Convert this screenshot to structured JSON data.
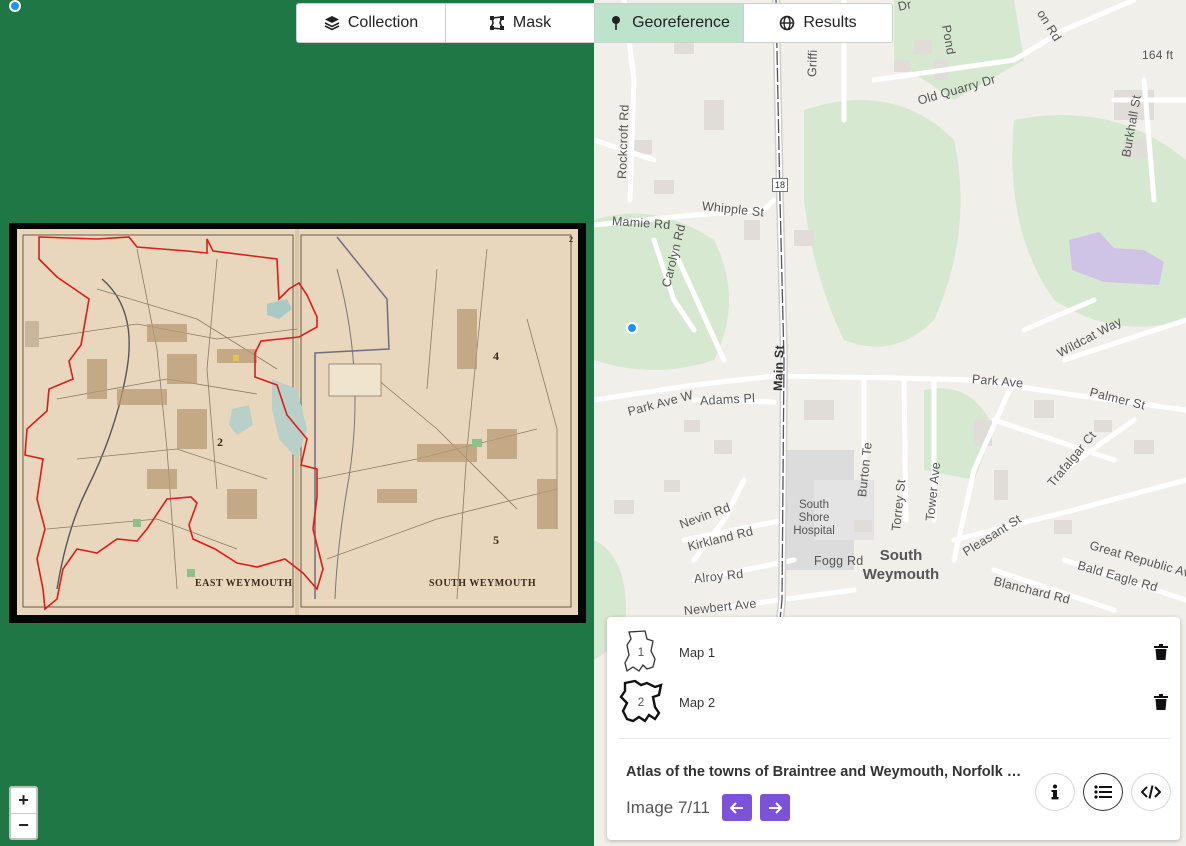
{
  "tabs": [
    {
      "label": "Collection",
      "icon": "layers-icon"
    },
    {
      "label": "Mask",
      "icon": "mask-icon"
    },
    {
      "label": "Georeference",
      "icon": "pin-icon"
    },
    {
      "label": "Results",
      "icon": "globe-icon"
    }
  ],
  "active_tab": "Georeference",
  "atlas": {
    "label_east": "EAST WEYMOUTH",
    "label_south": "SOUTH WEYMOUTH",
    "number_2": "2",
    "number_4": "4",
    "number_5": "5",
    "page_number": "2"
  },
  "zoom": {
    "in": "+",
    "out": "−"
  },
  "map": {
    "roads": {
      "rockcroft": "Rockcroft Rd",
      "mamie": "Mamie Rd",
      "whipple": "Whipple St",
      "carolyn": "Carolyn Rd",
      "main": "Main St",
      "park_ave_w": "Park Ave W",
      "adams": "Adams Pl",
      "park_ave": "Park Ave",
      "palmer": "Palmer St",
      "wildcat": "Wildcat Way",
      "trafalgar": "Trafalgar Ct",
      "burton": "Burton Te",
      "torrey": "Torrey St",
      "tower": "Tower Ave",
      "pleasant": "Pleasant St",
      "nevin": "Nevin Rd",
      "kirkland": "Kirkland Rd",
      "alroy": "Alroy Rd",
      "fogg": "Fogg Rd",
      "newbert": "Newbert Ave",
      "great_republic": "Great Republic Av",
      "bald_eagle": "Bald Eagle Rd",
      "blanchard": "Blanchard Rd",
      "old_quarry": "Old Quarry Dr",
      "burkhall": "Burkhall St",
      "griffin": "Griffi",
      "dr_top": "Dr",
      "rd_top": "on Rd",
      "pond": "Pond",
      "elevation": "164 ft"
    },
    "route_shield": "18",
    "place": "South Weymouth",
    "poi": "South Shore Hospital"
  },
  "panel": {
    "maps": [
      {
        "name": "Map 1",
        "number": "1"
      },
      {
        "name": "Map 2",
        "number": "2"
      }
    ],
    "atlas_title": "Atlas of the towns of Braintree and Weymouth, Norfolk County, Massachusetts",
    "image_counter": "Image 7/11",
    "buttons": [
      "info-icon",
      "list-icon",
      "code-icon"
    ]
  },
  "colors": {
    "left_bg": "#1e7745",
    "active_tab": "#bde3cc",
    "nav_button": "#7b52d8",
    "mask_outline": "#e01b1b",
    "dot": "#1e90ff"
  }
}
